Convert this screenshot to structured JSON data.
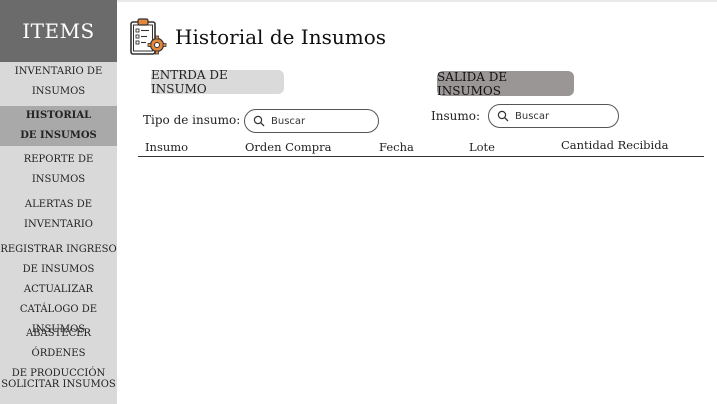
{
  "sidebar": {
    "brand": "ITEMS",
    "items": [
      {
        "line1": "INVENTARIO DE",
        "line2": "INSUMOS"
      },
      {
        "line1": "HISTORIAL",
        "line2": "DE INSUMOS"
      },
      {
        "line1": "REPORTE DE",
        "line2": "INSUMOS"
      },
      {
        "line1": "ALERTAS DE",
        "line2": "INVENTARIO"
      },
      {
        "line1": "REGISTRAR INGRESO",
        "line2": "DE INSUMOS"
      },
      {
        "line1": "ACTUALIZAR",
        "line2": "CATÁLOGO DE INSUMOS"
      },
      {
        "line1": "ABASTECER ÓRDENES",
        "line2": "DE PRODUCCIÓN"
      },
      {
        "line1": "SOLICITAR INSUMOS"
      }
    ],
    "active_index": 1
  },
  "header": {
    "title": "Historial de Insumos",
    "icon": "clipboard-gear-icon"
  },
  "actions": {
    "entrada_label": "ENTRDA DE INSUMO",
    "salida_label": "SALIDA DE INSUMOS"
  },
  "filters": {
    "tipo_label": "Tipo de insumo:",
    "tipo_placeholder": "Buscar",
    "insumo_label": "Insumo:",
    "insumo_placeholder": "Buscar"
  },
  "table": {
    "columns": [
      "Insumo",
      "Orden Compra",
      "Fecha",
      "Lote",
      "Cantidad Recibida"
    ],
    "rows": []
  },
  "colors": {
    "sidebar_bg": "#d9d9d9",
    "brand_bg": "#6b6b6b",
    "active_bg": "#a9a9a9",
    "salida_bg": "#9a9696",
    "entrada_bg": "#dadada"
  }
}
